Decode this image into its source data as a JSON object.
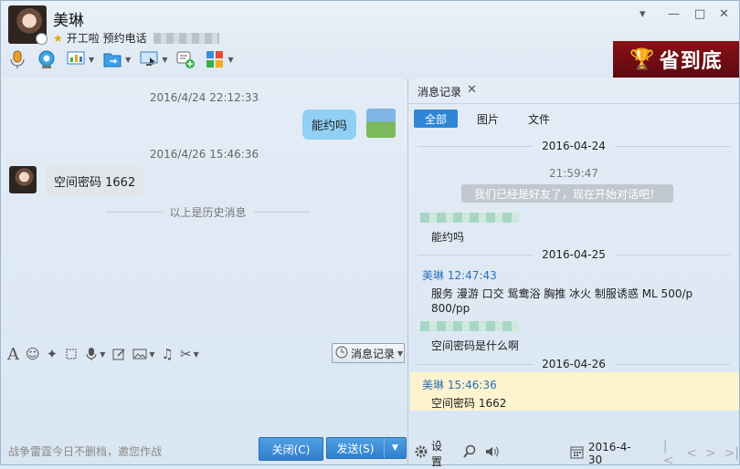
{
  "contact": {
    "name": "美琳",
    "status": "开工啦 预约电话"
  },
  "window_controls": {
    "menu": "▾",
    "minimize": "—",
    "maximize": "□",
    "close": "✕"
  },
  "ad": {
    "text": "省到底"
  },
  "chat": {
    "messages": [
      {
        "timestamp": "2016/4/24 22:12:33",
        "text": "能约吗",
        "from": "me"
      },
      {
        "timestamp": "2016/4/26 15:46:36",
        "text": "空间密码 1662",
        "from": "contact"
      }
    ],
    "history_separator": "以上是历史消息"
  },
  "input_toolbar": {
    "history_button": "消息记录"
  },
  "footer": {
    "ad_text": "战争雷霆今日不删档，邀您作战",
    "close_button": "关闭(C)",
    "send_button": "发送(S)"
  },
  "record_panel": {
    "tab_title": "消息记录",
    "filters": [
      "全部",
      "图片",
      "文件"
    ],
    "entries": {
      "date1": "2016-04-24",
      "time1": "21:59:47",
      "system_message": "我们已经是好友了，现在开始对话吧！",
      "msg1": "能约吗",
      "date2": "2016-04-25",
      "sender2": "美琳 12:47:43",
      "msg2_line1": "服务 漫游 口交  鸳鸯浴  胸推 冰火 制服诱惑 ML 500/p",
      "msg2_line2": "800/pp",
      "msg3": "空间密码是什么啊",
      "date3": "2016-04-26",
      "sender4": "美琳 15:46:36",
      "msg4": "空间密码 1662"
    },
    "bottom": {
      "settings": "设置",
      "date": "2016-4-30"
    }
  },
  "colors": {
    "accent": "#2f86d6",
    "bubble_me": "#8fd0f4",
    "bubble_contact": "#e2e6ea",
    "highlight": "#fdf3cf"
  }
}
